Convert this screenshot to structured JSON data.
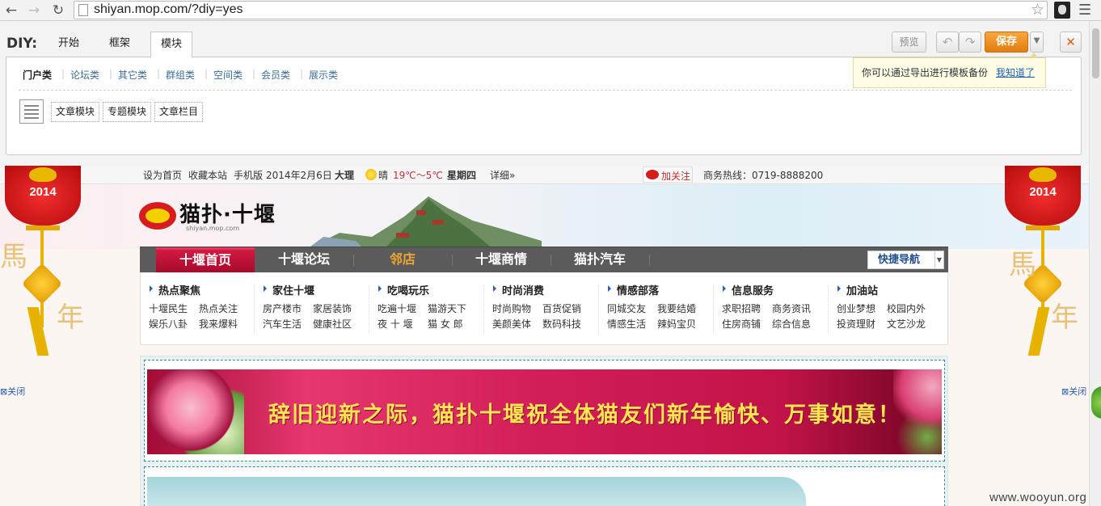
{
  "browser": {
    "url": "shiyan.mop.com/?diy=yes"
  },
  "diy": {
    "brand": "DIY:",
    "tabs": [
      {
        "label": "开始"
      },
      {
        "label": "框架"
      },
      {
        "label": "模块"
      }
    ],
    "categories": [
      "门户类",
      "论坛类",
      "其它类",
      "群组类",
      "空间类",
      "会员类",
      "展示类"
    ],
    "modules": [
      "文章模块",
      "专题模块",
      "文章栏目"
    ],
    "preview_label": "预览",
    "save_label": "保存",
    "close_label": "✕",
    "tip": {
      "text": "你可以通过导出进行模板备份",
      "link": "我知道了"
    }
  },
  "site": {
    "topbar": {
      "set_home": "设为首页",
      "bookmark": "收藏本站",
      "mobile": "手机版",
      "date": "2014年2月6日",
      "city": "大理",
      "weather": "晴",
      "temp": "19℃～5℃",
      "weekday": "星期四",
      "detail": "详细»",
      "follow": "加关注",
      "hotline": "商务热线：0719-8888200"
    },
    "logo": {
      "name": "猫扑·十堰",
      "sub": "shiyan.mop.com"
    },
    "lantern_year": "2014",
    "close_ad": "⊠关闭",
    "nav": [
      {
        "label": "十堰首页",
        "active": true
      },
      {
        "label": "十堰论坛"
      },
      {
        "label": "邻店",
        "highlight": true
      },
      {
        "label": "十堰商情"
      },
      {
        "label": "猫扑汽车"
      }
    ],
    "quick_nav": "快捷导航",
    "columns": [
      {
        "title": "热点聚焦",
        "rows": [
          [
            "十堰民生",
            "热点关注"
          ],
          [
            "娱乐八卦",
            "我来爆料"
          ]
        ]
      },
      {
        "title": "家住十堰",
        "rows": [
          [
            "房产楼市",
            "家居装饰"
          ],
          [
            "汽车生活",
            "健康社区"
          ]
        ]
      },
      {
        "title": "吃喝玩乐",
        "rows": [
          [
            "吃遍十堰",
            "猫游天下"
          ],
          [
            "夜 十 堰",
            "猫 女 郎"
          ]
        ]
      },
      {
        "title": "时尚消费",
        "rows": [
          [
            "时尚购物",
            "百货促销"
          ],
          [
            "美颜美体",
            "数码科技"
          ]
        ]
      },
      {
        "title": "情感部落",
        "rows": [
          [
            "同城交友",
            "我要结婚"
          ],
          [
            "情感生活",
            "辣妈宝贝"
          ]
        ]
      },
      {
        "title": "信息服务",
        "rows": [
          [
            "求职招聘",
            "商务资讯"
          ],
          [
            "住房商铺",
            "综合信息"
          ]
        ]
      },
      {
        "title": "加油站",
        "rows": [
          [
            "创业梦想",
            "校园内外"
          ],
          [
            "投资理财",
            "文艺沙龙"
          ]
        ]
      }
    ],
    "banner_text": "辞旧迎新之际，猫扑十堰祝全体猫友们新年愉快、万事如意！"
  },
  "watermark": "www.wooyun.org",
  "colors": {
    "nav_bg": "#5b5b5b",
    "nav_active": "#c3103a",
    "save_orange": "#ef8f1f",
    "link_blue": "#3c6e9a",
    "banner_text": "#ffe552"
  }
}
